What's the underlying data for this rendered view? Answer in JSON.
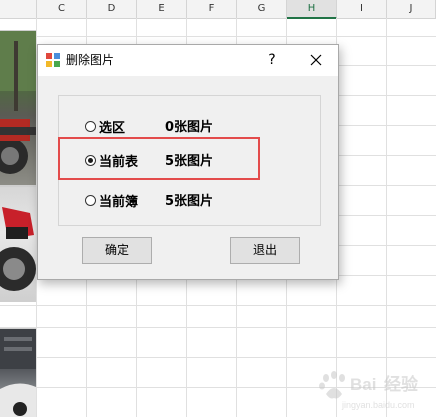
{
  "spreadsheet": {
    "columns": [
      {
        "label": "C"
      },
      {
        "label": "D"
      },
      {
        "label": "E"
      },
      {
        "label": "F"
      },
      {
        "label": "G"
      },
      {
        "label": "H"
      },
      {
        "label": "I"
      },
      {
        "label": "J"
      }
    ],
    "active_column": "H"
  },
  "dialog": {
    "title": "删除图片",
    "help_label": "?",
    "options": [
      {
        "label": "选区",
        "count": "0张图片",
        "checked": false
      },
      {
        "label": "当前表",
        "count": "5张图片",
        "checked": true
      },
      {
        "label": "当前簿",
        "count": "5张图片",
        "checked": false
      }
    ],
    "ok_label": "确定",
    "exit_label": "退出"
  },
  "colors": {
    "highlight": "#e34b4b",
    "active_column_accent": "#217346"
  },
  "watermark": {
    "text": "Baidu经验"
  }
}
